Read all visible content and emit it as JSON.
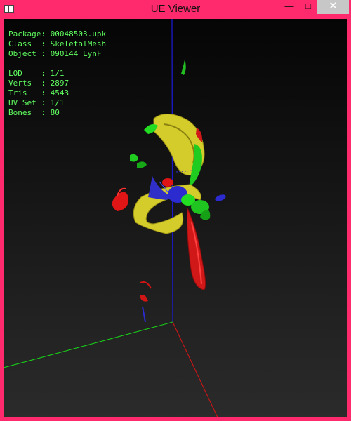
{
  "window": {
    "title": "UE Viewer",
    "buttons": {
      "minimize": "—",
      "maximize": "□",
      "close": "✕"
    },
    "accent_color": "#ff2a6d"
  },
  "viewer": {
    "package": "Package: 00048503.upk",
    "class": "Class  : SkeletalMesh",
    "object": "Object : 090144_LynF",
    "lod": "LOD    : 1/1",
    "verts": "Verts  : 2897",
    "tris": "Tris   : 4543",
    "uvset": "UV Set : 1/1",
    "bones": "Bones  : 80",
    "text_color": "#60ff60"
  },
  "scene": {
    "axis_colors": {
      "x": "#ff0000",
      "y": "#00ff00",
      "z": "#0000ff"
    },
    "mesh_colors": [
      "#d4cc2a",
      "#22dd22",
      "#e01515",
      "#2b2bd0"
    ]
  }
}
